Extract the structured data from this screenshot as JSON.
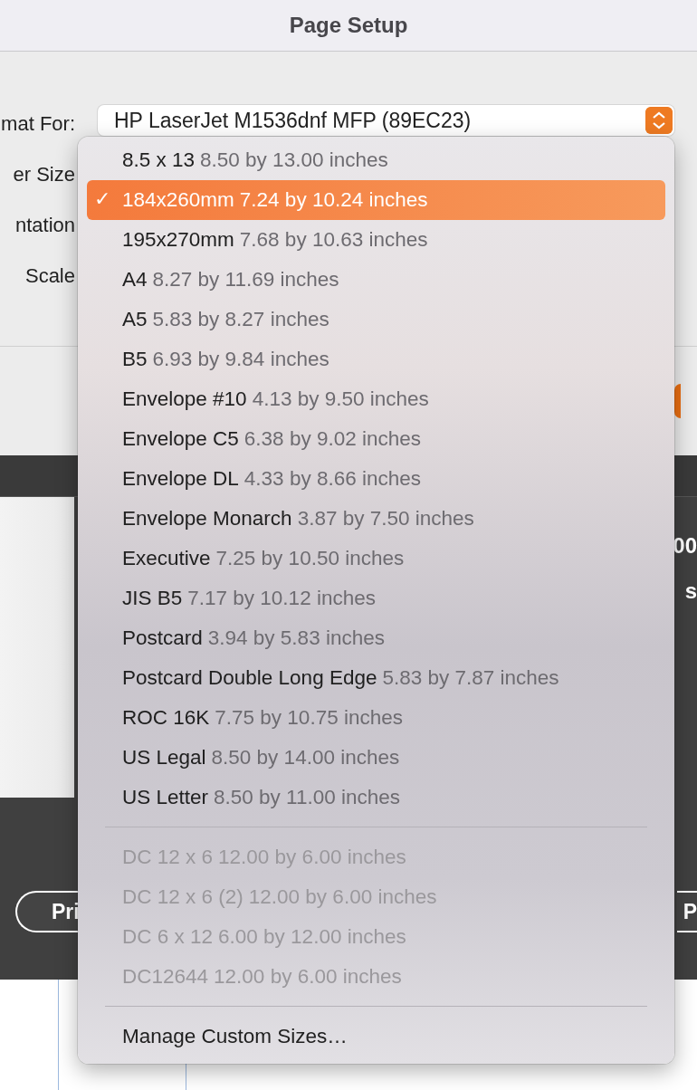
{
  "window": {
    "title": "Page Setup"
  },
  "form": {
    "labels": [
      "mat For:",
      "er Size",
      "ntation",
      "Scale"
    ],
    "printer_popup": {
      "value": "HP LaserJet M1536dnf MFP (89EC23)"
    }
  },
  "behind": {
    "right_texts": [
      "00",
      "s"
    ],
    "left_button": "Pri",
    "right_button": "P"
  },
  "paper_menu": {
    "check_mark": "✓",
    "sections": [
      {
        "items": [
          {
            "kind": "size",
            "name": "8.5 x 13",
            "size": "8.50 by 13.00 inches",
            "selected": false,
            "disabled": false
          },
          {
            "kind": "size",
            "name": "184x260mm",
            "size": "7.24 by 10.24 inches",
            "selected": true,
            "disabled": false
          },
          {
            "kind": "size",
            "name": "195x270mm",
            "size": "7.68 by 10.63 inches",
            "selected": false,
            "disabled": false
          },
          {
            "kind": "size",
            "name": "A4",
            "size": "8.27 by 11.69 inches",
            "selected": false,
            "disabled": false
          },
          {
            "kind": "size",
            "name": "A5",
            "size": "5.83 by 8.27 inches",
            "selected": false,
            "disabled": false
          },
          {
            "kind": "size",
            "name": "B5",
            "size": "6.93 by 9.84 inches",
            "selected": false,
            "disabled": false
          },
          {
            "kind": "size",
            "name": "Envelope #10",
            "size": "4.13 by 9.50 inches",
            "selected": false,
            "disabled": false
          },
          {
            "kind": "size",
            "name": "Envelope C5",
            "size": "6.38 by 9.02 inches",
            "selected": false,
            "disabled": false
          },
          {
            "kind": "size",
            "name": "Envelope DL",
            "size": "4.33 by 8.66 inches",
            "selected": false,
            "disabled": false
          },
          {
            "kind": "size",
            "name": "Envelope Monarch",
            "size": "3.87 by 7.50 inches",
            "selected": false,
            "disabled": false
          },
          {
            "kind": "size",
            "name": "Executive",
            "size": "7.25 by 10.50 inches",
            "selected": false,
            "disabled": false
          },
          {
            "kind": "size",
            "name": "JIS B5",
            "size": "7.17 by 10.12 inches",
            "selected": false,
            "disabled": false
          },
          {
            "kind": "size",
            "name": "Postcard",
            "size": "3.94 by 5.83 inches",
            "selected": false,
            "disabled": false
          },
          {
            "kind": "size",
            "name": "Postcard Double Long Edge",
            "size": "5.83 by 7.87 inches",
            "selected": false,
            "disabled": false
          },
          {
            "kind": "size",
            "name": "ROC 16K",
            "size": "7.75 by 10.75 inches",
            "selected": false,
            "disabled": false
          },
          {
            "kind": "size",
            "name": "US Legal",
            "size": "8.50 by 14.00 inches",
            "selected": false,
            "disabled": false
          },
          {
            "kind": "size",
            "name": "US Letter",
            "size": "8.50 by 11.00 inches",
            "selected": false,
            "disabled": false
          }
        ]
      },
      {
        "items": [
          {
            "kind": "size",
            "name": "DC 12 x 6",
            "size": "12.00 by 6.00 inches",
            "selected": false,
            "disabled": true
          },
          {
            "kind": "size",
            "name": "DC 12 x 6 (2)",
            "size": "12.00 by 6.00 inches",
            "selected": false,
            "disabled": true
          },
          {
            "kind": "size",
            "name": "DC 6 x 12",
            "size": "6.00 by 12.00 inches",
            "selected": false,
            "disabled": true
          },
          {
            "kind": "size",
            "name": "DC12644",
            "size": "12.00 by 6.00 inches",
            "selected": false,
            "disabled": true
          }
        ]
      },
      {
        "items": [
          {
            "kind": "action",
            "name": "Manage Custom Sizes…",
            "selected": false,
            "disabled": false
          }
        ]
      }
    ]
  }
}
